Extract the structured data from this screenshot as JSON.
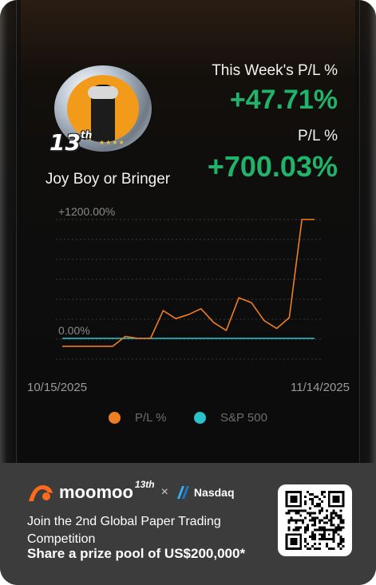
{
  "profile": {
    "username": "Joy Boy or Bringer",
    "badge_number": "13",
    "badge_suffix": "th"
  },
  "stats": {
    "week_label": "This Week's P/L %",
    "week_value": "+47.71%",
    "total_label": "P/L %",
    "total_value": "+700.03%"
  },
  "colors": {
    "accent_green": "#1fb46a",
    "series_pl": "#ef7d22",
    "series_sp500": "#2ac3c9",
    "background": "#0d0d0d",
    "footer": "#3c3c3c"
  },
  "chart_data": {
    "type": "line",
    "y_tick_labels": [
      "+1200.00%",
      "0.00%"
    ],
    "ylim": [
      -100,
      1400
    ],
    "x_tick_labels": [
      "10/15/2025",
      "11/14/2025"
    ],
    "grid": true,
    "legend_position": "bottom",
    "series": [
      {
        "name": "P/L %",
        "values": [
          -80,
          -80,
          -80,
          -80,
          -80,
          20,
          0,
          0,
          280,
          200,
          240,
          300,
          160,
          80,
          410,
          360,
          180,
          100,
          210,
          1200,
          1200
        ]
      },
      {
        "name": "S&P 500",
        "values": [
          0,
          0,
          0,
          0,
          0,
          0,
          0,
          0,
          0,
          0,
          0,
          0,
          0,
          0,
          0,
          0,
          0,
          0,
          0,
          0,
          0
        ]
      }
    ]
  },
  "footer": {
    "brand": "moomoo",
    "brand_sup": "13th",
    "separator": "×",
    "partner": "Nasdaq",
    "promo_line": "Join the 2nd Global Paper Trading Competition",
    "promo_headline": "Share a prize pool of US$200,000*"
  }
}
